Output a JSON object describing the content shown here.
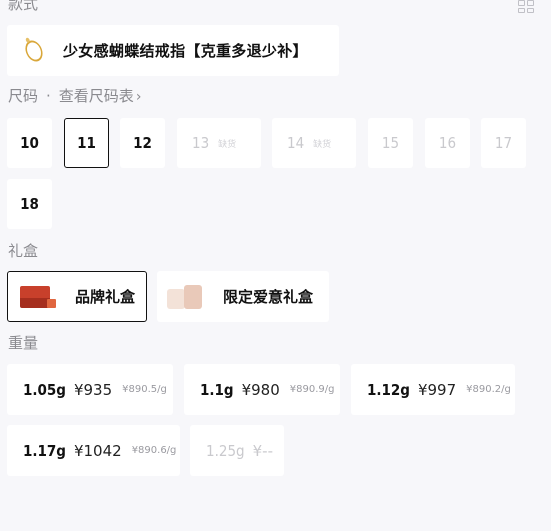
{
  "style_section": {
    "label": "款式",
    "item_name": "少女感蝴蝶结戒指【克重多退少补】"
  },
  "size_section": {
    "label": "尺码",
    "separator": "·",
    "size_chart_link": "查看尺码表",
    "chevron": "›",
    "sizes": [
      {
        "label": "10",
        "state": "available"
      },
      {
        "label": "11",
        "state": "selected"
      },
      {
        "label": "12",
        "state": "available"
      },
      {
        "label": "13",
        "state": "soldout",
        "tag": "缺货"
      },
      {
        "label": "14",
        "state": "soldout",
        "tag": "缺货"
      },
      {
        "label": "15",
        "state": "disabled"
      },
      {
        "label": "16",
        "state": "disabled"
      },
      {
        "label": "17",
        "state": "disabled"
      },
      {
        "label": "18",
        "state": "available"
      }
    ]
  },
  "gift_section": {
    "label": "礼盒",
    "options": [
      {
        "label": "品牌礼盒",
        "state": "selected",
        "icon": "red-gift-box-icon"
      },
      {
        "label": "限定爱意礼盒",
        "state": "available",
        "icon": "pink-gift-box-icon"
      }
    ]
  },
  "weight_section": {
    "label": "重量",
    "options": [
      {
        "weight": "1.05g",
        "price": "¥935",
        "unit_price": "¥890.5/g",
        "state": "available"
      },
      {
        "weight": "1.1g",
        "price": "¥980",
        "unit_price": "¥890.9/g",
        "state": "available"
      },
      {
        "weight": "1.12g",
        "price": "¥997",
        "unit_price": "¥890.2/g",
        "state": "available"
      },
      {
        "weight": "1.17g",
        "price": "¥1042",
        "unit_price": "¥890.6/g",
        "state": "available"
      },
      {
        "weight": "1.25g",
        "price": "¥--",
        "unit_price": "",
        "state": "disabled"
      }
    ]
  },
  "colors": {
    "accent": "#111111",
    "disabled": "#c9c9cd",
    "background": "#f7f7fa"
  }
}
